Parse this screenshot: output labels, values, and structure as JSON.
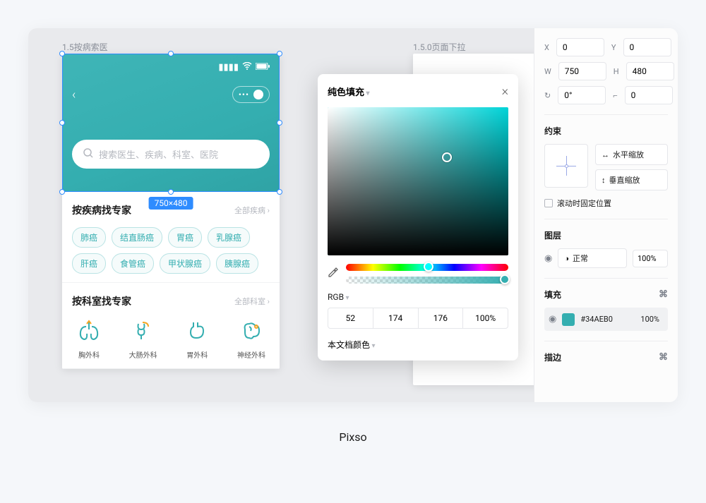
{
  "app_name": "Pixso",
  "canvas": {
    "frame1_label": "1.5按病索医",
    "frame2_label": "1.5.0页面下拉",
    "selection_size": "750×480"
  },
  "mobile": {
    "search_placeholder": "搜索医生、疾病、科室、医院",
    "disease_section_title": "按疾病找专家",
    "disease_section_link": "全部疾病",
    "disease_tags": [
      "肺癌",
      "结直肠癌",
      "胃癌",
      "乳腺癌",
      "肝癌",
      "食管癌",
      "甲状腺癌",
      "胰腺癌"
    ],
    "dept_section_title": "按科室找专家",
    "dept_section_link": "全部科室",
    "depts": [
      "胸外科",
      "大肠外科",
      "胃外科",
      "神经外科"
    ]
  },
  "picker": {
    "title": "纯色填充",
    "mode": "RGB",
    "r": "52",
    "g": "174",
    "b": "176",
    "a": "100%",
    "doc_colors": "本文档颜色"
  },
  "panel": {
    "x_label": "X",
    "x": "0",
    "y_label": "Y",
    "y": "0",
    "w_label": "W",
    "w": "750",
    "h_label": "H",
    "h": "480",
    "rot_label": "↻",
    "rot": "0°",
    "corner_label": "⌐",
    "corner": "0",
    "constraints_title": "约束",
    "constraint_h": "水平缩放",
    "constraint_v": "垂直缩放",
    "scroll_fix": "滚动时固定位置",
    "layer_title": "图层",
    "blend_mode": "正常",
    "layer_opacity": "100%",
    "fill_title": "填充",
    "fill_hex": "#34AEB0",
    "fill_opacity": "100%",
    "stroke_title": "描边"
  }
}
